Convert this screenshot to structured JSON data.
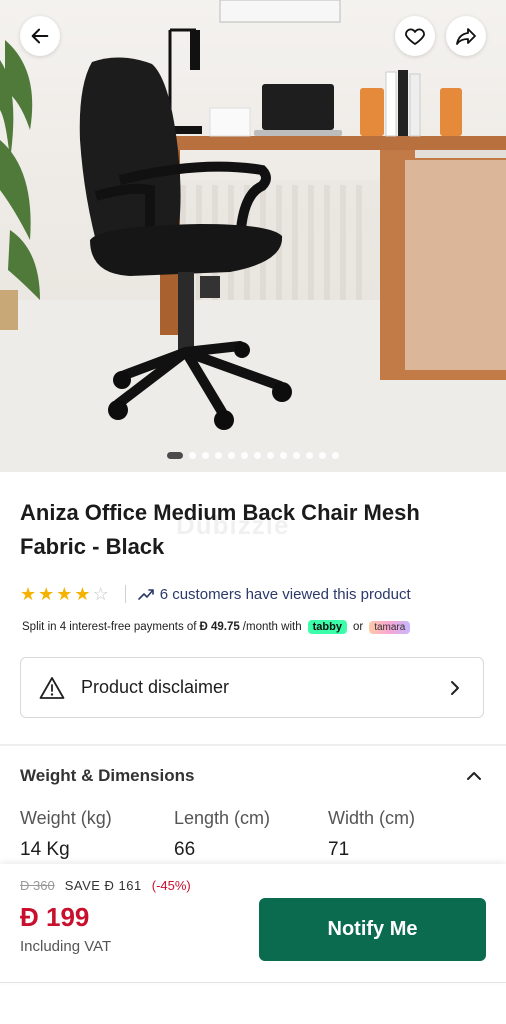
{
  "gallery": {
    "image_alt": "Black mesh office chair in front of a wooden desk",
    "slide_count": 13,
    "active_slide": 1
  },
  "product": {
    "title": "Aniza Office Medium Back Chair Mesh Fabric - Black",
    "watermark": "Dubizzle",
    "rating": 4,
    "rating_max": 5,
    "views_text": "6 customers have viewed this product"
  },
  "installments": {
    "prefix": "Split in 4 interest-free payments of",
    "currency": "Đ",
    "amount": "49.75",
    "suffix": "/month with",
    "provider_1": "tabby",
    "or": "or",
    "provider_2": "tamara"
  },
  "disclaimer": {
    "label": "Product disclaimer"
  },
  "weight_dimensions": {
    "heading": "Weight & Dimensions",
    "columns": [
      {
        "label": "Weight (kg)",
        "value": "14 Kg"
      },
      {
        "label": "Length (cm)",
        "value": "66"
      },
      {
        "label": "Width (cm)",
        "value": "71"
      }
    ]
  },
  "pricing": {
    "old_price": "Đ 360",
    "save_text": "SAVE Đ 161",
    "discount": "(-45%)",
    "price": "Đ 199",
    "vat_note": "Including VAT"
  },
  "cta": {
    "label": "Notify Me"
  },
  "colors": {
    "accent": "#0a6b4f",
    "sale": "#c8102e",
    "star": "#f5b301",
    "link": "#2b3a6b"
  }
}
